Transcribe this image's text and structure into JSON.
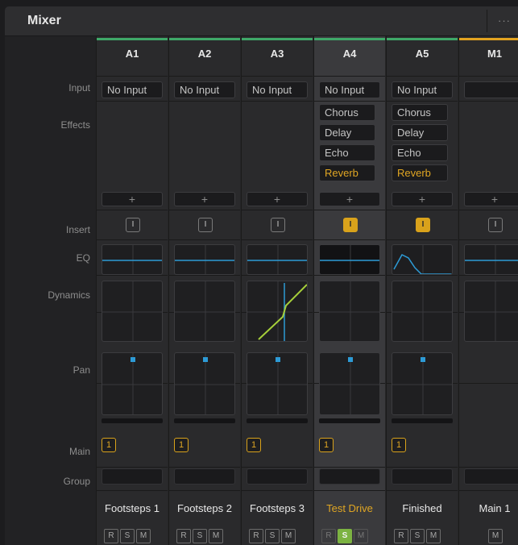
{
  "window": {
    "title": "Mixer",
    "more_icon": "more-dots-icon",
    "more_label": "···"
  },
  "rows": {
    "input": "Input",
    "effects": "Effects",
    "insert": "Insert",
    "eq": "EQ",
    "dynamics": "Dynamics",
    "pan": "Pan",
    "main": "Main",
    "group": "Group"
  },
  "colors": {
    "audio_track": "#3fa868",
    "main_bus": "#e2a320",
    "active": "#e0a623",
    "solo": "#7cb342",
    "meter": "#2d9bd6"
  },
  "channels": [
    {
      "id": "A1",
      "input": "No Input",
      "effects": [],
      "plus": "+",
      "insert": "I",
      "insert_on": false,
      "eq": "flat",
      "dyn": "flat",
      "pan": "center",
      "main": "1",
      "name": "Footsteps 1",
      "r": "R",
      "s": "S",
      "m": "M",
      "solo": false
    },
    {
      "id": "A2",
      "input": "No Input",
      "effects": [],
      "plus": "+",
      "insert": "I",
      "insert_on": false,
      "eq": "flat",
      "dyn": "flat",
      "pan": "center",
      "main": "1",
      "name": "Footsteps 2",
      "r": "R",
      "s": "S",
      "m": "M",
      "solo": false
    },
    {
      "id": "A3",
      "input": "No Input",
      "effects": [],
      "plus": "+",
      "insert": "I",
      "insert_on": false,
      "eq": "flat",
      "dyn": "compressor",
      "pan": "center",
      "main": "1",
      "name": "Footsteps 3",
      "r": "R",
      "s": "S",
      "m": "M",
      "solo": false
    },
    {
      "id": "A4",
      "input": "No Input",
      "effects": [
        {
          "label": "Chorus",
          "active": false
        },
        {
          "label": "Delay",
          "active": false
        },
        {
          "label": "Echo",
          "active": false
        },
        {
          "label": "Reverb",
          "active": true
        }
      ],
      "plus": "+",
      "insert": "I",
      "insert_on": true,
      "eq": "flat",
      "dyn": "flat",
      "pan": "center",
      "main": "1",
      "name": "Test Drive",
      "r": "R",
      "s": "S",
      "m": "M",
      "solo": true,
      "selected": true
    },
    {
      "id": "A5",
      "input": "No Input",
      "effects": [
        {
          "label": "Chorus",
          "active": false
        },
        {
          "label": "Delay",
          "active": false
        },
        {
          "label": "Echo",
          "active": false
        },
        {
          "label": "Reverb",
          "active": true
        }
      ],
      "plus": "+",
      "insert": "I",
      "insert_on": true,
      "eq": "lowpass",
      "dyn": "flat",
      "pan": "center",
      "main": "1",
      "name": "Finished",
      "r": "R",
      "s": "S",
      "m": "M",
      "solo": false
    },
    {
      "id": "M1",
      "input": "",
      "effects": [],
      "plus": "+",
      "insert": "I",
      "insert_on": false,
      "eq": "flat",
      "dyn": "flat",
      "pan": "none",
      "main": "",
      "name": "Main 1",
      "m": "M",
      "bus": true
    }
  ]
}
